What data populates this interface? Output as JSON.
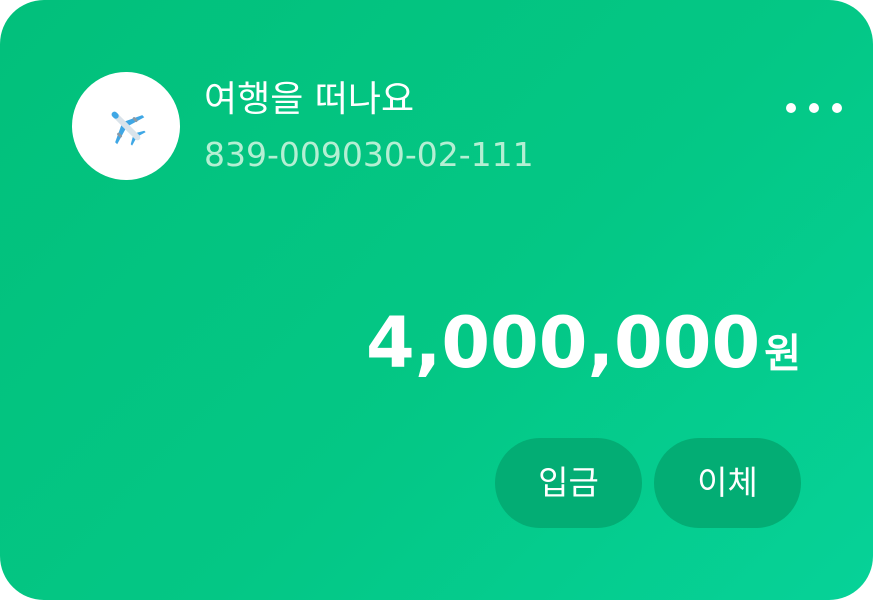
{
  "account": {
    "icon": "airplane-icon",
    "name": "여행을 떠나요",
    "number": "839-009030-02-111",
    "balance": "4,000,000",
    "currency_unit": "원"
  },
  "menu": {
    "icon": "more-horizontal-icon"
  },
  "actions": {
    "deposit_label": "입금",
    "transfer_label": "이체"
  },
  "colors": {
    "card_gradient_start": "#02c07b",
    "card_gradient_end": "#06d298",
    "button_bg": "#03ad74",
    "account_number_text": "#b4efd3",
    "airplane_blue": "#3fa7e5"
  }
}
